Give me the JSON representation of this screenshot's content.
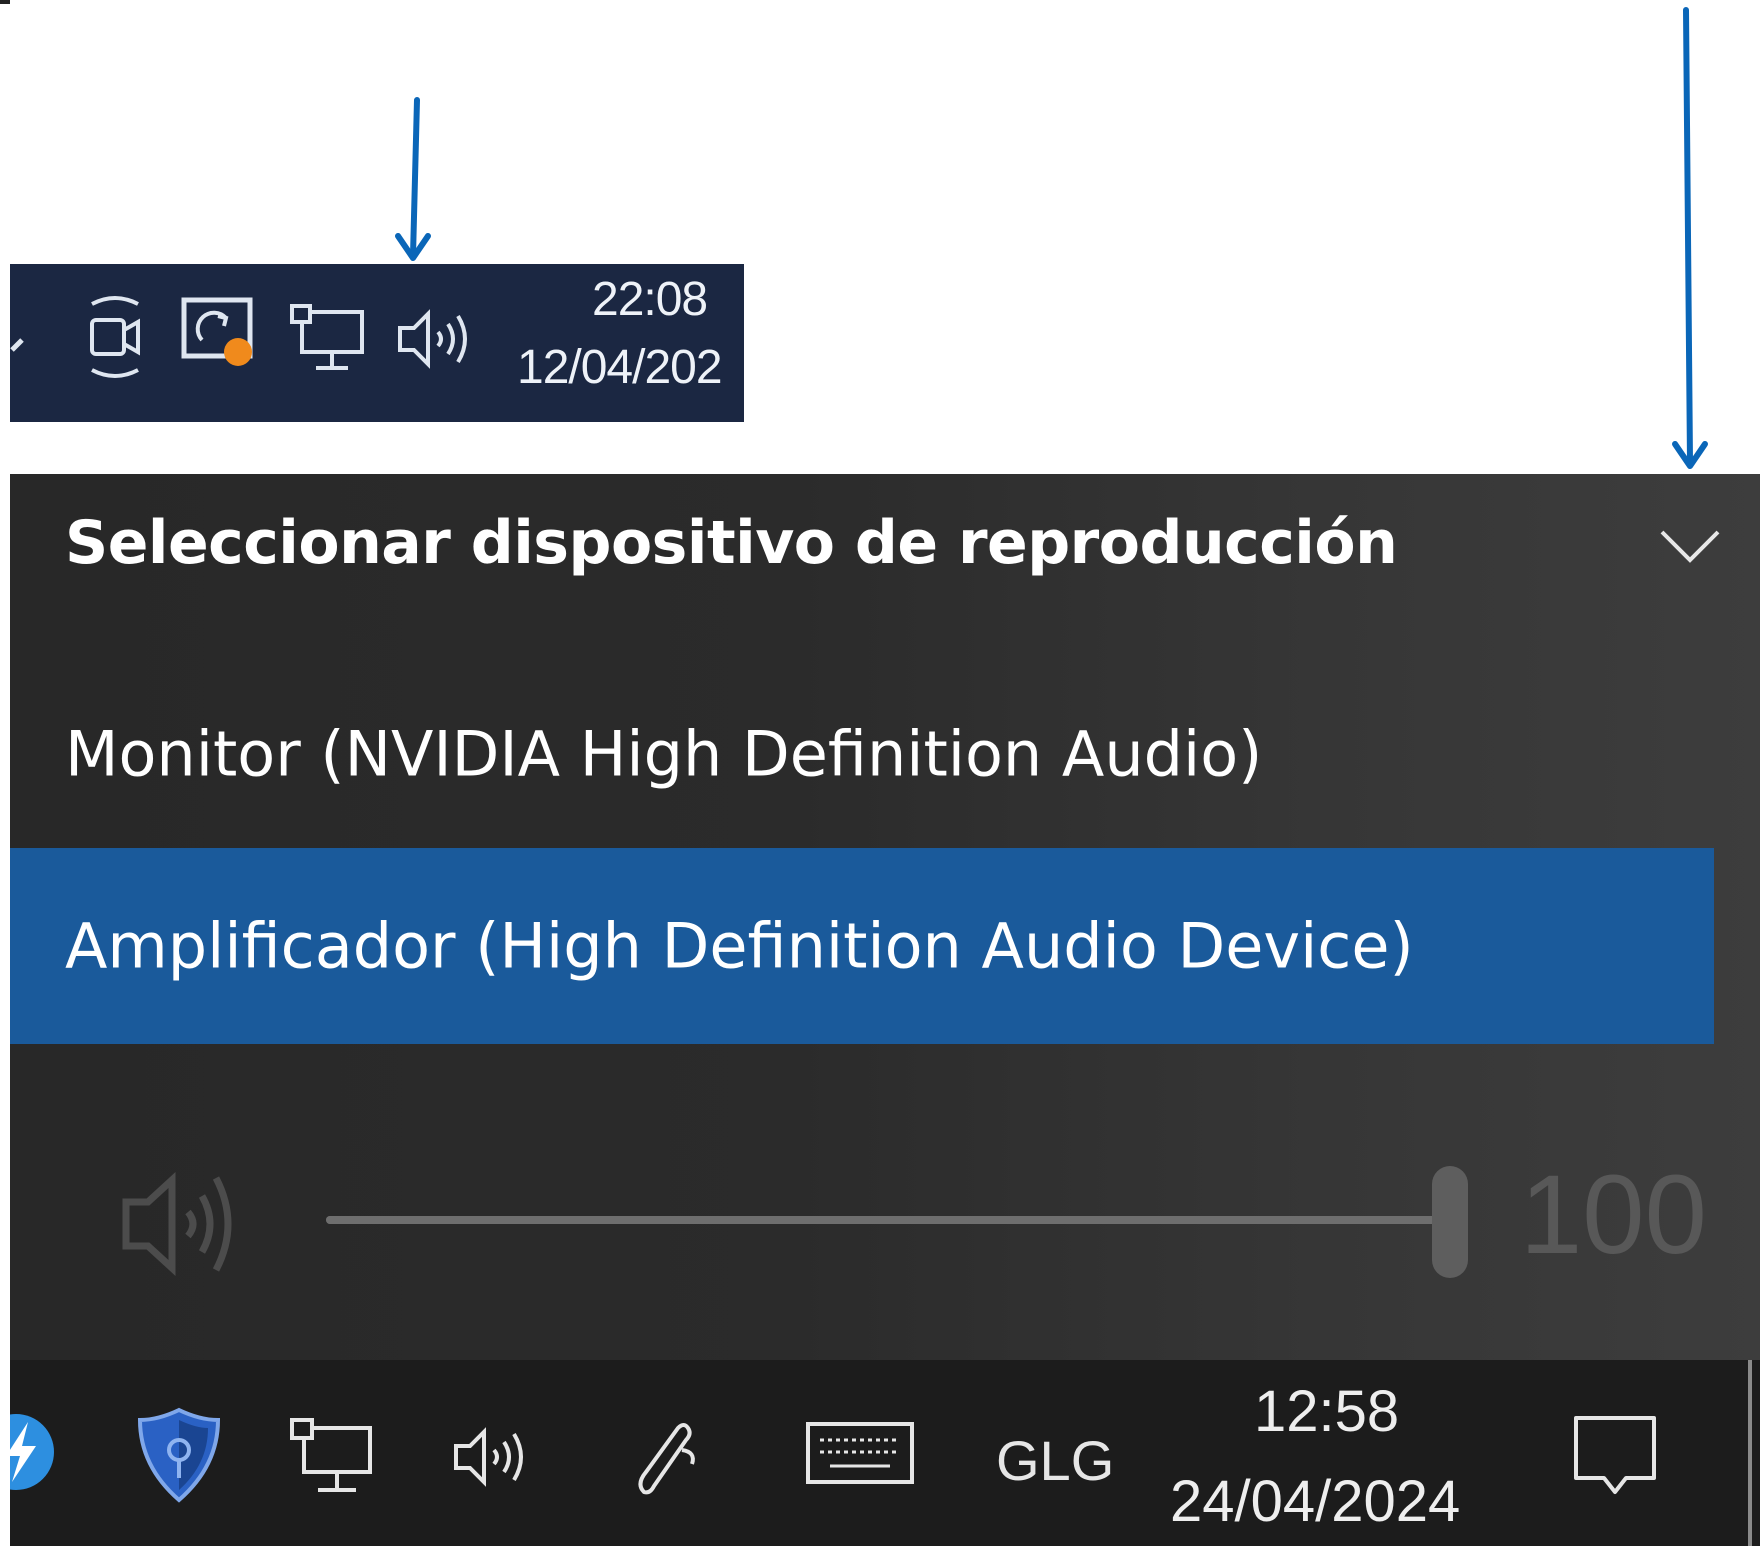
{
  "top_taskbar": {
    "clock_time": "22:08",
    "clock_date": "12/04/202",
    "icons": [
      "show-hidden-icons-chevron-icon",
      "meet-now-camera-icon",
      "sync-app-with-notification-icon",
      "network-icon",
      "volume-icon"
    ],
    "notification_dot_color": "#f08a1c",
    "background_color": "#1b2742"
  },
  "flyout": {
    "header": "Seleccionar dispositivo de reproducción",
    "devices": [
      {
        "label": "Monitor (NVIDIA High Definition Audio)",
        "selected": false
      },
      {
        "label": "Amplificador (High Definition Audio Device)",
        "selected": true
      }
    ],
    "volume": {
      "value": "100",
      "level": 1.0
    },
    "selected_color": "#1a5a9b"
  },
  "bottom_taskbar": {
    "icons": [
      "app-partial-icon",
      "security-shield-icon",
      "network-icon",
      "volume-icon",
      "pen-icon",
      "touch-keyboard-icon",
      "action-center-icon"
    ],
    "language": "GLG",
    "clock_time": "12:58",
    "clock_date": "24/04/2024"
  },
  "annotation_color": "#0a66b8"
}
